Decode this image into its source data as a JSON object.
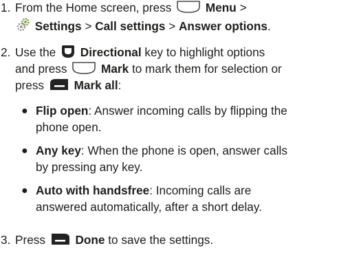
{
  "steps": [
    {
      "number": "1.",
      "line1_a": "From the Home screen, press",
      "menu_label": "Menu",
      "line1_b": ">",
      "settings_label": "Settings",
      "sep1": ">",
      "call_settings_label": "Call settings",
      "sep2": ">",
      "answer_options_label": "Answer options",
      "end": ".",
      "icons": [
        "menu-key-icon",
        "settings-gear-icon"
      ]
    },
    {
      "number": "2.",
      "text_a": "Use the",
      "directional_label": "Directional",
      "text_b": "key to highlight options",
      "text_c": "and press",
      "mark_label": "Mark",
      "text_d": "to mark them for selection or",
      "text_e": "press",
      "mark_all_label": "Mark all",
      "text_f": ":",
      "icons": [
        "directional-key-icon",
        "center-key-icon",
        "left-softkey-icon"
      ]
    },
    {
      "number": "3.",
      "text_a": "Press",
      "done_label": "Done",
      "text_b": "to save the settings.",
      "icons": [
        "right-softkey-icon"
      ]
    }
  ],
  "bullets": [
    {
      "term": "Flip open",
      "sep": ":",
      "line1": "Answer incoming calls by flipping the",
      "line2": "phone open."
    },
    {
      "term": "Any key",
      "sep": ":",
      "line1": "When the phone is open, answer calls",
      "line2": "by pressing any key."
    },
    {
      "term": "Auto with handsfree",
      "sep": ":",
      "line1": "Incoming calls are",
      "line2": "answered automatically, after a short delay."
    }
  ],
  "colors": {
    "text": "#1d1d1b",
    "key_fill": "#222222",
    "key_outline": "#4a4a4a",
    "gear_green": "#6e9a2a",
    "gear_gray": "#9a9a9a"
  }
}
